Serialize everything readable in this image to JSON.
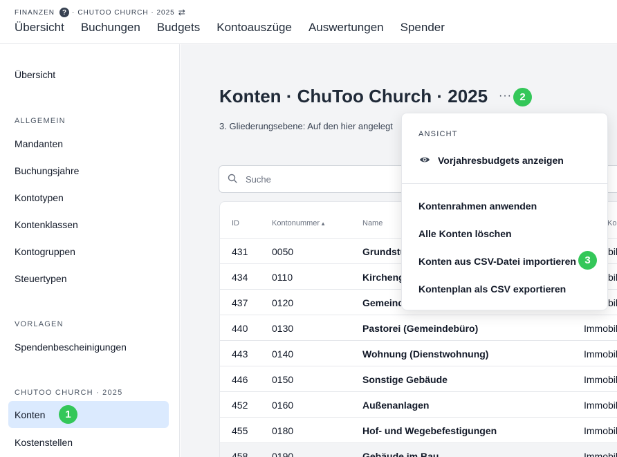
{
  "header": {
    "breadcrumb_app": "FINANZEN",
    "breadcrumb_sep": "·",
    "breadcrumb_context": "CHUTOO CHURCH · 2025",
    "nav": [
      "Übersicht",
      "Buchungen",
      "Budgets",
      "Kontoauszüge",
      "Auswertungen",
      "Spender"
    ]
  },
  "sidebar": {
    "overview": "Übersicht",
    "section_general": "ALLGEMEIN",
    "general_items": [
      "Mandanten",
      "Buchungsjahre",
      "Kontotypen",
      "Kontenklassen",
      "Kontogruppen",
      "Steuertypen"
    ],
    "section_templates": "VORLAGEN",
    "template_items": [
      "Spendenbescheinigungen"
    ],
    "section_context": "CHUTOO CHURCH · 2025",
    "context_items": [
      "Konten",
      "Kostenstellen"
    ],
    "active_item": "Konten"
  },
  "badges": [
    "1",
    "2",
    "3"
  ],
  "main": {
    "title": "Konten · ChuToo Church · 2025",
    "more": "···",
    "description": "3. Gliederungsebene: Auf den hier angelegt",
    "search_placeholder": "Suche"
  },
  "table": {
    "columns": [
      "ID",
      "Kontonummer",
      "Name",
      "Kontogru"
    ],
    "sort_indicator": "▲",
    "rows": [
      {
        "id": "431",
        "number": "0050",
        "name": "Grundstü",
        "group": "Immobil"
      },
      {
        "id": "434",
        "number": "0110",
        "name": "Kircheng",
        "group": "Immobil"
      },
      {
        "id": "437",
        "number": "0120",
        "name": "Gemeind",
        "group": "Immobil"
      },
      {
        "id": "440",
        "number": "0130",
        "name": "Pastorei (Gemeindebüro)",
        "group": "Immobil"
      },
      {
        "id": "443",
        "number": "0140",
        "name": "Wohnung (Dienstwohnung)",
        "group": "Immobil"
      },
      {
        "id": "446",
        "number": "0150",
        "name": "Sonstige Gebäude",
        "group": "Immobil"
      },
      {
        "id": "452",
        "number": "0160",
        "name": "Außenanlagen",
        "group": "Immobil"
      },
      {
        "id": "455",
        "number": "0180",
        "name": "Hof- und Wegebefestigungen",
        "group": "Immobil"
      },
      {
        "id": "458",
        "number": "0190",
        "name": "Gebäude im Bau",
        "group": "Immobil"
      }
    ]
  },
  "dropdown": {
    "section": "ANSICHT",
    "view_item": "Vorjahresbudgets anzeigen",
    "actions": [
      "Kontenrahmen anwenden",
      "Alle Konten löschen",
      "Konten aus CSV-Datei importieren",
      "Kontenplan als CSV exportieren"
    ]
  },
  "colors": {
    "accent_active": "#dbeafe",
    "badge_green": "#34c759",
    "main_bg": "#f3f4f6"
  }
}
